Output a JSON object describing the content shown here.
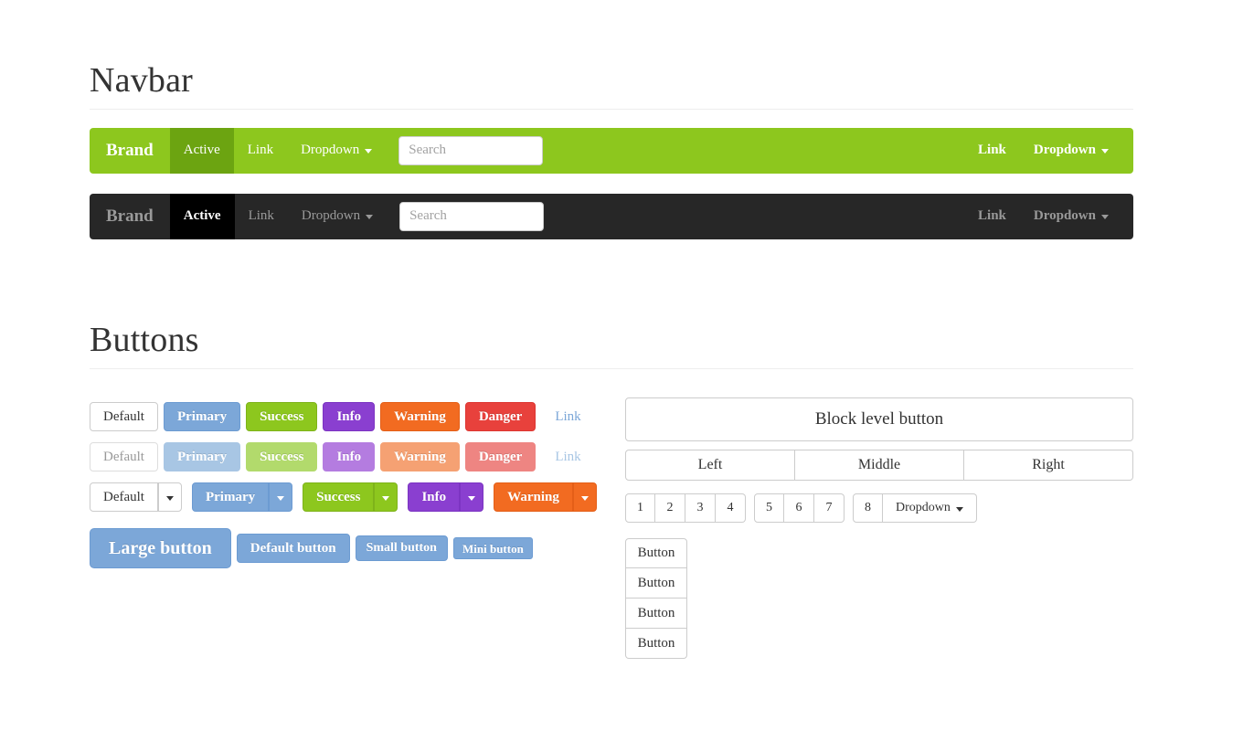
{
  "sections": {
    "navbar": {
      "title": "Navbar"
    },
    "buttons": {
      "title": "Buttons"
    }
  },
  "navbars": [
    {
      "variant": "default",
      "brand": "Brand",
      "left_items": [
        {
          "label": "Active",
          "active": true,
          "caret": false
        },
        {
          "label": "Link",
          "active": false,
          "caret": false
        },
        {
          "label": "Dropdown",
          "active": false,
          "caret": true
        }
      ],
      "search_placeholder": "Search",
      "search_value": "",
      "right_items": [
        {
          "label": "Link",
          "caret": false
        },
        {
          "label": "Dropdown",
          "caret": true
        }
      ]
    },
    {
      "variant": "inverse",
      "brand": "Brand",
      "left_items": [
        {
          "label": "Active",
          "active": true,
          "caret": false
        },
        {
          "label": "Link",
          "active": false,
          "caret": false
        },
        {
          "label": "Dropdown",
          "active": false,
          "caret": true
        }
      ],
      "search_placeholder": "Search",
      "search_value": "",
      "right_items": [
        {
          "label": "Link",
          "caret": false
        },
        {
          "label": "Dropdown",
          "caret": true
        }
      ]
    }
  ],
  "button_rows": {
    "normal": [
      {
        "label": "Default",
        "style": "default"
      },
      {
        "label": "Primary",
        "style": "primary"
      },
      {
        "label": "Success",
        "style": "success"
      },
      {
        "label": "Info",
        "style": "info"
      },
      {
        "label": "Warning",
        "style": "warning"
      },
      {
        "label": "Danger",
        "style": "danger"
      },
      {
        "label": "Link",
        "style": "link"
      }
    ],
    "disabled": [
      {
        "label": "Default",
        "style": "default"
      },
      {
        "label": "Primary",
        "style": "primary"
      },
      {
        "label": "Success",
        "style": "success"
      },
      {
        "label": "Info",
        "style": "info"
      },
      {
        "label": "Warning",
        "style": "warning"
      },
      {
        "label": "Danger",
        "style": "danger"
      },
      {
        "label": "Link",
        "style": "link"
      }
    ],
    "split_dropdowns": [
      {
        "label": "Default",
        "style": "default"
      },
      {
        "label": "Primary",
        "style": "primary"
      },
      {
        "label": "Success",
        "style": "success"
      },
      {
        "label": "Info",
        "style": "info"
      },
      {
        "label": "Warning",
        "style": "warning"
      }
    ],
    "sizes": [
      {
        "label": "Large button",
        "size": "large"
      },
      {
        "label": "Default button",
        "size": "default"
      },
      {
        "label": "Small button",
        "size": "small"
      },
      {
        "label": "Mini button",
        "size": "mini"
      }
    ]
  },
  "right_column": {
    "block_button": "Block level button",
    "justified_group": [
      "Left",
      "Middle",
      "Right"
    ],
    "numbered_groups": [
      {
        "items": [
          "1",
          "2",
          "3",
          "4"
        ]
      },
      {
        "items": [
          "5",
          "6",
          "7"
        ]
      },
      {
        "items": [
          "8"
        ],
        "dropdown_label": "Dropdown"
      }
    ],
    "vertical_group": [
      "Button",
      "Button",
      "Button",
      "Button"
    ]
  },
  "colors": {
    "navbar_green": "#8dc71e",
    "navbar_green_active": "#6ca411",
    "navbar_inverse": "#272727",
    "navbar_inverse_active": "#000000",
    "primary": "#7ca7d8",
    "success": "#8dc71e",
    "info": "#8a3fd0",
    "warning": "#f26b21",
    "danger": "#e8413c",
    "link": "#7ca7d8",
    "text": "#333333",
    "border": "#cccccc",
    "hr": "#eeeeee"
  }
}
